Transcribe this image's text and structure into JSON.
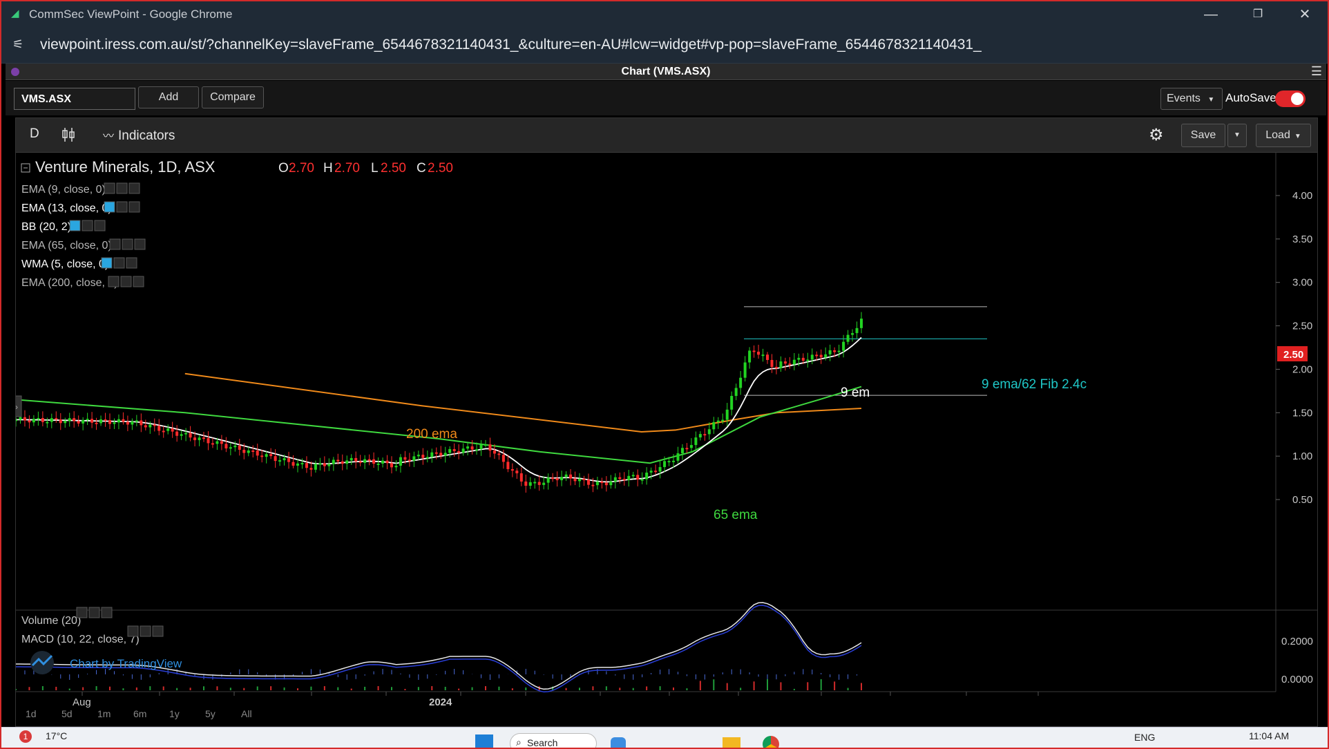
{
  "browser": {
    "window_title": "CommSec ViewPoint - Google Chrome",
    "url": "viewpoint.iress.com.au/st/?channelKey=slaveFrame_6544678321140431_&culture=en-AU#lcw=widget#vp-pop=slaveFrame_6544678321140431_"
  },
  "widget": {
    "title": "Chart (VMS.ASX)"
  },
  "symbol_bar": {
    "symbol": "VMS.ASX",
    "add_label": "Add",
    "compare_label": "Compare",
    "events_label": "Events",
    "autosave_label": "AutoSave",
    "autosave_on": true
  },
  "toolbar": {
    "interval": "D",
    "indicators_label": "Indicators",
    "save_label": "Save",
    "load_label": "Load"
  },
  "legend": {
    "title": "Venture Minerals, 1D, ASX",
    "o_label": "O",
    "o_value": "2.70",
    "h_label": "H",
    "h_value": "2.70",
    "l_label": "L",
    "l_value": "2.50",
    "c_label": "C",
    "c_value": "2.50",
    "indicators": [
      "EMA (9, close, 0)",
      "EMA (13, close, 0)",
      "BB (20, 2)",
      "EMA (65, close, 0)",
      "WMA (5, close, 0)",
      "EMA (200, close, 0)"
    ],
    "lower_indicators": [
      "Volume (20)",
      "MACD (10, 22, close, 7)"
    ]
  },
  "annotations": {
    "ema200": "200 ema",
    "ema65": "65 ema",
    "ema9": "9 em",
    "fib": "9 ema/62 Fib 2.4c"
  },
  "branding": {
    "tradingview": "Chart by TradingView"
  },
  "chart_data": {
    "type": "candlestick",
    "title": "Venture Minerals, 1D, ASX",
    "price_axis_ticks": [
      "4.00",
      "3.50",
      "3.00",
      "2.50",
      "2.00",
      "1.50",
      "1.00",
      "0.50"
    ],
    "last_price": "2.50",
    "macd_axis_ticks": [
      "0.2000",
      "0.0000"
    ],
    "x_tick_labels": [
      "Aug",
      "2024"
    ],
    "ylim": [
      0.2,
      4.3
    ],
    "horizontal_levels": [
      2.72,
      2.35,
      1.7
    ],
    "ema200": [
      [
        0.2,
        1.95
      ],
      [
        0.48,
        1.58
      ],
      [
        0.74,
        1.28
      ],
      [
        0.78,
        1.3
      ],
      [
        0.85,
        1.42
      ],
      [
        0.9,
        1.5
      ],
      [
        1.0,
        1.55
      ]
    ],
    "ema65": [
      [
        0.0,
        1.65
      ],
      [
        0.2,
        1.5
      ],
      [
        0.5,
        1.2
      ],
      [
        0.62,
        1.05
      ],
      [
        0.75,
        0.92
      ],
      [
        0.8,
        1.05
      ],
      [
        0.88,
        1.45
      ],
      [
        0.95,
        1.65
      ],
      [
        1.0,
        1.8
      ]
    ],
    "colors": {
      "up": "#22d322",
      "down": "#ff2b2b",
      "ema200": "#f08a1a",
      "ema65": "#3fd93f",
      "ema9": "#ffffff",
      "fib": "#1fc7c7",
      "price_tag": "#e02020"
    }
  },
  "taskbar": {
    "temperature": "17°C",
    "language": "ENG",
    "time": "11:04 AM",
    "search": "Search",
    "range_buttons": [
      "1d",
      "5d",
      "1m",
      "6m",
      "1y",
      "5y",
      "All"
    ]
  }
}
